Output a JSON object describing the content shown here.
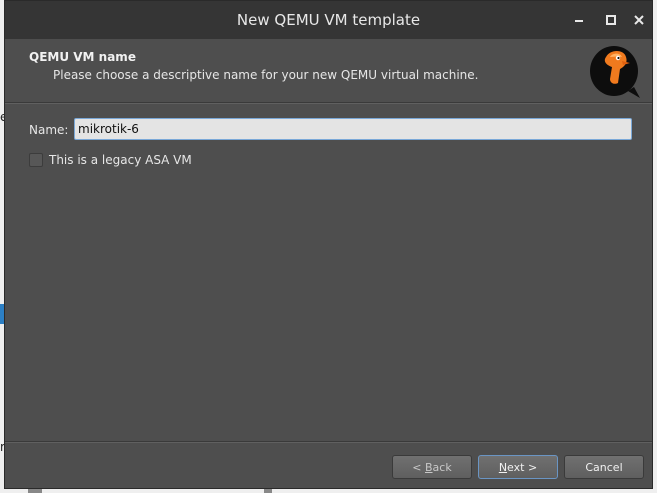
{
  "window": {
    "title": "New QEMU VM template"
  },
  "header": {
    "title": "QEMU VM name",
    "subtitle": "Please choose a descriptive name for your new QEMU virtual machine.",
    "logo_icon": "qemu-logo"
  },
  "form": {
    "name_label": "Name:",
    "name_value": "mikrotik-6",
    "legacy_asa_label": "This is a legacy ASA VM",
    "legacy_asa_checked": false
  },
  "buttons": {
    "back_prefix": "< ",
    "back_mnemonic": "B",
    "back_rest": "ack",
    "next_mnemonic": "N",
    "next_rest": "ext >",
    "cancel": "Cancel"
  },
  "colors": {
    "window_bg": "#4e4e4e",
    "titlebar_bg": "#353535",
    "input_focus_border": "#7aa8d8"
  }
}
